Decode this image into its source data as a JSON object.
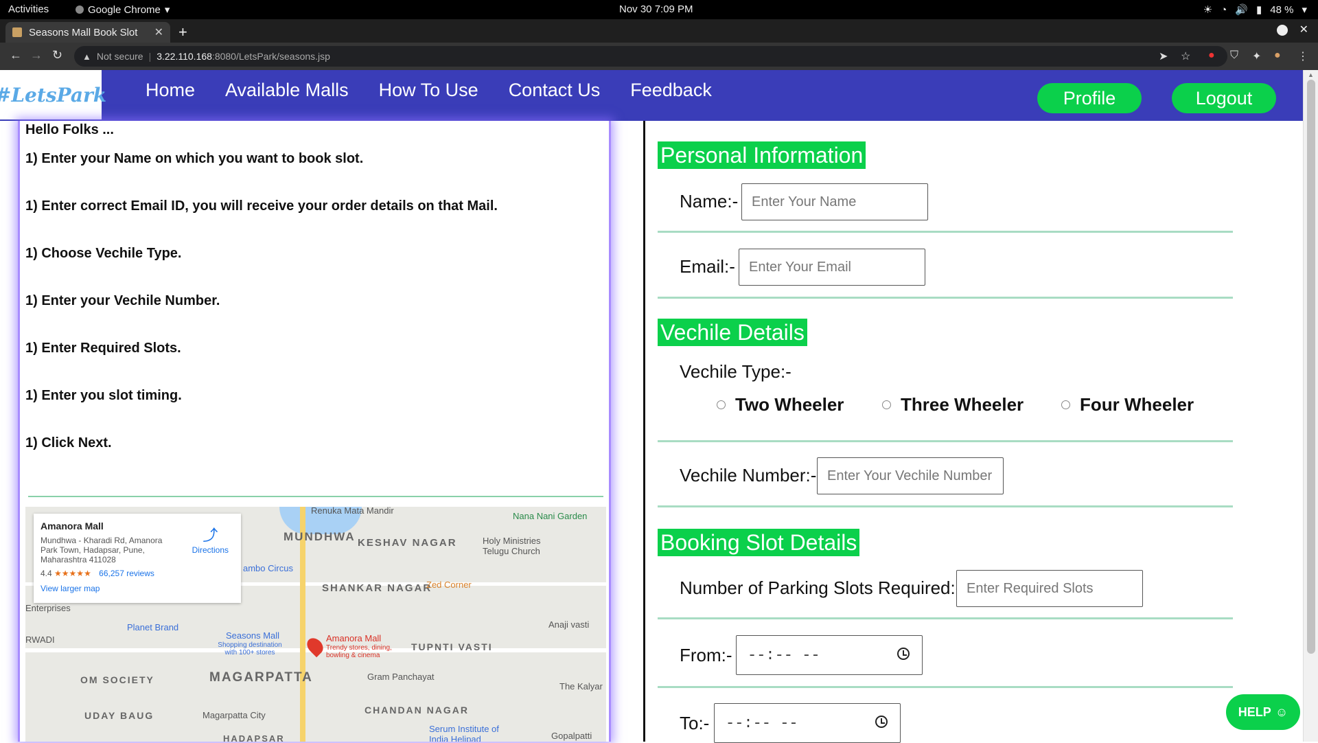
{
  "os": {
    "activities": "Activities",
    "app_name": "Google Chrome",
    "datetime": "Nov 30  7:09 PM",
    "battery": "48 %"
  },
  "browser": {
    "tab_title": "Seasons Mall Book Slot",
    "not_secure": "Not secure",
    "url_host": "3.22.110.168",
    "url_rest": ":8080/LetsPark/seasons.jsp"
  },
  "site": {
    "logo": "#LetsPark",
    "nav": [
      "Home",
      "Available Malls",
      "How To Use",
      "Contact Us",
      "Feedback"
    ],
    "profile_label": "Profile",
    "logout_label": "Logout"
  },
  "instructions": {
    "greeting": "Hello Folks ...",
    "steps": [
      "1) Enter your Name on which you want to book slot.",
      "1) Enter correct Email ID, you will receive your order details on that Mail.",
      "1) Choose Vechile Type.",
      "1) Enter your Vechile Number.",
      "1) Enter Required Slots.",
      "1) Enter you slot timing.",
      "1) Click Next."
    ]
  },
  "map": {
    "place_name": "Amanora Mall",
    "address": "Mundhwa - Kharadi Rd, Amanora Park Town, Hadapsar, Pune, Maharashtra 411028",
    "rating": "4.4",
    "stars": "★★★★★",
    "reviews": "66,257 reviews",
    "directions": "Directions",
    "larger_map": "View larger map",
    "labels": {
      "mundhwa": "MUNDHWA",
      "keshav": "KESHAV NAGAR",
      "shankar": "SHANKAR NAGAR",
      "magarpatta": "MAGARPATTA",
      "tupnti": "TUPNTI VASTI",
      "chandan": "CHANDAN NAGAR",
      "udaybaug": "UDAY BAUG",
      "omsociety": "OM SOCIETY",
      "nananani": "Nana Nani Garden",
      "holyministries": "Holy Ministries Telugu Church",
      "zedcorner": "Zed Corner",
      "planetbrand": "Planet Brand",
      "seasonsmall": "Seasons Mall",
      "seasonsmall_sub": "Shopping destination with 100+ stores",
      "amanora_pin": "Amanora Mall",
      "amanora_sub": "Trendy stores, dining, bowling & cinema",
      "grampanchayat": "Gram Panchayat",
      "kalyan": "The Kalyar",
      "magarpattacity": "Magarpatta City",
      "serum": "Serum Institute of India Helipad",
      "gopalpatti": "Gopalpatti",
      "anaji": "Anaji vasti",
      "ambocircus": "ambo Circus",
      "renuka": "Renuka Mata Mandir",
      "hadapsar": "HADAPSAR",
      "enterprises": "Enterprises",
      "rwadi": "RWADI"
    }
  },
  "form": {
    "personal_heading": "Personal Information",
    "name_label": "Name:-",
    "name_placeholder": "Enter Your Name",
    "email_label": "Email:-",
    "email_placeholder": "Enter Your Email",
    "vehicle_heading": "Vechile Details",
    "vehicle_type_label": "Vechile Type:-",
    "vehicle_options": [
      "Two Wheeler",
      "Three Wheeler",
      "Four Wheeler"
    ],
    "vehicle_number_label": "Vechile Number:-",
    "vehicle_number_placeholder": "Enter Your Vechile Number",
    "booking_heading": "Booking Slot Details",
    "slots_label": "Number of Parking Slots Required:-",
    "slots_placeholder": "Enter Required Slots",
    "from_label": "From:-",
    "from_value": "--:--  --",
    "to_label": "To:-",
    "to_value": "--:--  --"
  },
  "help_label": "HELP",
  "colors": {
    "nav_bg": "#3a3db8",
    "accent_green": "#0bd04b",
    "panel_glow": "#8c6eff"
  }
}
